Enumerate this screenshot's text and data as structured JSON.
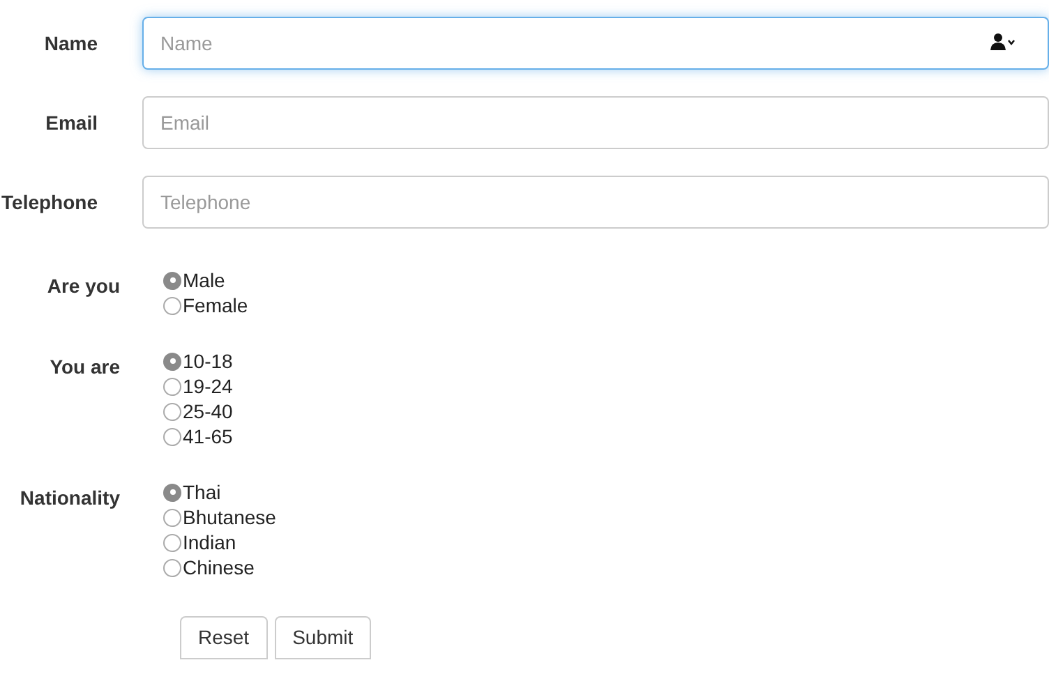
{
  "fields": [
    {
      "label": "Name",
      "placeholder": "Name",
      "focused": true,
      "kind": "contact"
    },
    {
      "label": "Email",
      "placeholder": "Email",
      "focused": false,
      "kind": "plain"
    },
    {
      "label": "Telephone",
      "placeholder": "Telephone",
      "focused": false,
      "kind": "plain"
    }
  ],
  "radio_groups": [
    {
      "label": "Are you",
      "options": [
        {
          "label": "Male",
          "selected": true
        },
        {
          "label": "Female",
          "selected": false
        }
      ]
    },
    {
      "label": "You are",
      "options": [
        {
          "label": "10-18",
          "selected": true
        },
        {
          "label": "19-24",
          "selected": false
        },
        {
          "label": "25-40",
          "selected": false
        },
        {
          "label": "41-65",
          "selected": false
        }
      ]
    },
    {
      "label": "Nationality",
      "options": [
        {
          "label": "Thai",
          "selected": true
        },
        {
          "label": "Bhutanese",
          "selected": false
        },
        {
          "label": "Indian",
          "selected": false
        },
        {
          "label": "Chinese",
          "selected": false
        }
      ]
    }
  ],
  "buttons": [
    "Reset",
    "Submit"
  ]
}
